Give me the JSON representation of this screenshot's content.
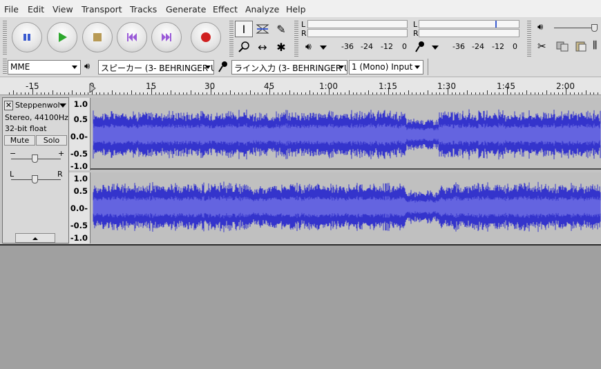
{
  "menu": [
    "File",
    "Edit",
    "View",
    "Transport",
    "Tracks",
    "Generate",
    "Effect",
    "Analyze",
    "Help"
  ],
  "meters": {
    "left_channel": "L",
    "right_channel": "R",
    "playback_ticks": [
      "-36",
      "-24",
      "-12",
      "0"
    ],
    "record_ticks": [
      "-36",
      "-24",
      "-12",
      "0"
    ]
  },
  "device": {
    "host": "MME",
    "output": "スピーカー (3- BEHRINGER U",
    "input": "ライン入力 (3- BEHRINGER U",
    "channels": "1 (Mono) Input"
  },
  "timeline": {
    "labels": [
      "-15",
      "0",
      "15",
      "30",
      "45",
      "1:00",
      "1:15",
      "1:30",
      "1:45",
      "2:00"
    ]
  },
  "track": {
    "name": "Steppenwol",
    "info_rate": "Stereo, 44100Hz",
    "info_format": "32-bit float",
    "mute_label": "Mute",
    "solo_label": "Solo",
    "gain_minus": "−",
    "gain_plus": "+",
    "pan_left": "L",
    "pan_right": "R",
    "scale": [
      "1.0",
      "0.5",
      "0.0-",
      "-0.5",
      "-1.0"
    ]
  },
  "colors": {
    "waveform": "#3434cc",
    "waveform_rms": "#6464e0",
    "play_green": "#2ea82e",
    "record_red": "#d02020",
    "pause_blue": "#3a5bd0"
  }
}
